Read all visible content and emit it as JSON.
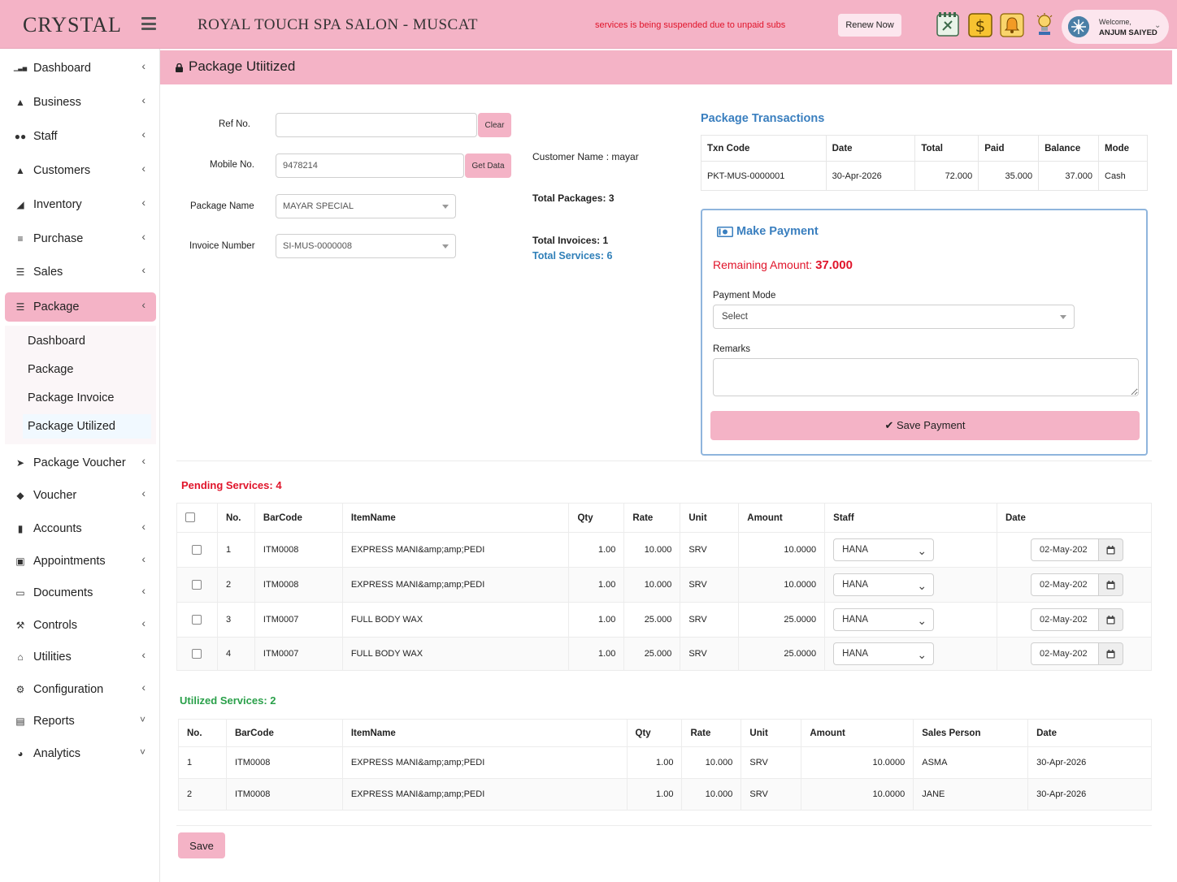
{
  "header": {
    "logo": "CRYSTAL",
    "salon_title": "ROYAL TOUCH SPA SALON - MUSCAT",
    "warning": "services is being suspended due to unpaid subs",
    "renew_label": "Renew Now",
    "welcome_label": "Welcome,",
    "user_name": "ANJUM SAIYED",
    "icons": [
      "phone-book-icon",
      "dollar-icon",
      "bell-icon",
      "lightbulb-icon"
    ]
  },
  "sidebar": {
    "items": [
      {
        "label": "Dashboard",
        "icon": "bar-chart-icon"
      },
      {
        "label": "Business",
        "icon": "bank-icon"
      },
      {
        "label": "Staff",
        "icon": "users-icon"
      },
      {
        "label": "Customers",
        "icon": "user-icon"
      },
      {
        "label": "Inventory",
        "icon": "chart-icon"
      },
      {
        "label": "Purchase",
        "icon": "cart-icon"
      },
      {
        "label": "Sales",
        "icon": "list-icon"
      },
      {
        "label": "Package",
        "icon": "list-icon"
      },
      {
        "label": "Package Voucher",
        "icon": "rocket-icon"
      },
      {
        "label": "Voucher",
        "icon": "tag-icon"
      },
      {
        "label": "Accounts",
        "icon": "book-icon"
      },
      {
        "label": "Appointments",
        "icon": "calendar-icon"
      },
      {
        "label": "Documents",
        "icon": "id-card-icon"
      },
      {
        "label": "Controls",
        "icon": "wrench-icon"
      },
      {
        "label": "Utilities",
        "icon": "bell-icon"
      },
      {
        "label": "Configuration",
        "icon": "gears-icon"
      },
      {
        "label": "Reports",
        "icon": "file-icon"
      },
      {
        "label": "Analytics",
        "icon": "pie-chart-icon"
      }
    ],
    "package_sub": [
      {
        "label": "Dashboard"
      },
      {
        "label": "Package"
      },
      {
        "label": "Package Invoice"
      },
      {
        "label": "Package Utilized"
      }
    ]
  },
  "page": {
    "title": "Package Utiitized"
  },
  "form": {
    "ref_label": "Ref No.",
    "ref_value": "",
    "clear_label": "Clear",
    "mobile_label": "Mobile No.",
    "mobile_value": "9478214",
    "get_data_label": "Get Data",
    "package_label": "Package Name",
    "package_value": "MAYAR SPECIAL",
    "invoice_label": "Invoice Number",
    "invoice_value": "SI-MUS-0000008"
  },
  "summary": {
    "customer": "Customer Name : mayar",
    "total_packages": "Total Packages: 3",
    "total_invoices": "Total Invoices: 1",
    "total_services": "Total Services: 6"
  },
  "transactions": {
    "title": "Package Transactions",
    "columns": [
      "Txn Code",
      "Date",
      "Total",
      "Paid",
      "Balance",
      "Mode"
    ],
    "rows": [
      [
        "PKT-MUS-0000001",
        "30-Apr-2026",
        "72.000",
        "35.000",
        "37.000",
        "Cash"
      ]
    ]
  },
  "payment": {
    "title": "Make Payment",
    "remaining_label": "Remaining Amount:",
    "remaining_value": "37.000",
    "mode_label": "Payment Mode",
    "mode_value": "Select",
    "remarks_label": "Remarks",
    "save_label": "Save Payment"
  },
  "pending": {
    "title": "Pending Services: 4",
    "columns": [
      "No.",
      "BarCode",
      "ItemName",
      "Qty",
      "Rate",
      "Unit",
      "Amount",
      "Staff",
      "Date"
    ],
    "rows": [
      {
        "no": "1",
        "barcode": "ITM0008",
        "item": "EXPRESS MANI&amp;amp;PEDI",
        "qty": "1.00",
        "rate": "10.000",
        "unit": "SRV",
        "amount": "10.0000",
        "staff": "HANA",
        "date": "02-May-202"
      },
      {
        "no": "2",
        "barcode": "ITM0008",
        "item": "EXPRESS MANI&amp;amp;PEDI",
        "qty": "1.00",
        "rate": "10.000",
        "unit": "SRV",
        "amount": "10.0000",
        "staff": "HANA",
        "date": "02-May-202"
      },
      {
        "no": "3",
        "barcode": "ITM0007",
        "item": "FULL BODY WAX",
        "qty": "1.00",
        "rate": "25.000",
        "unit": "SRV",
        "amount": "25.0000",
        "staff": "HANA",
        "date": "02-May-202"
      },
      {
        "no": "4",
        "barcode": "ITM0007",
        "item": "FULL BODY WAX",
        "qty": "1.00",
        "rate": "25.000",
        "unit": "SRV",
        "amount": "25.0000",
        "staff": "HANA",
        "date": "02-May-202"
      }
    ]
  },
  "utilized": {
    "title": "Utilized Services: 2",
    "columns": [
      "No.",
      "BarCode",
      "ItemName",
      "Qty",
      "Rate",
      "Unit",
      "Amount",
      "Sales Person",
      "Date"
    ],
    "rows": [
      {
        "no": "1",
        "barcode": "ITM0008",
        "item": "EXPRESS MANI&amp;amp;PEDI",
        "qty": "1.00",
        "rate": "10.000",
        "unit": "SRV",
        "amount": "10.0000",
        "person": "ASMA",
        "date": "30-Apr-2026"
      },
      {
        "no": "2",
        "barcode": "ITM0008",
        "item": "EXPRESS MANI&amp;amp;PEDI",
        "qty": "1.00",
        "rate": "10.000",
        "unit": "SRV",
        "amount": "10.0000",
        "person": "JANE",
        "date": "30-Apr-2026"
      }
    ]
  },
  "save_label": "Save",
  "colors": {
    "accent_pink": "#f4b3c6",
    "link_blue": "#3a7fbf",
    "alert_red": "#e0142a",
    "success_green": "#2aa04a"
  }
}
